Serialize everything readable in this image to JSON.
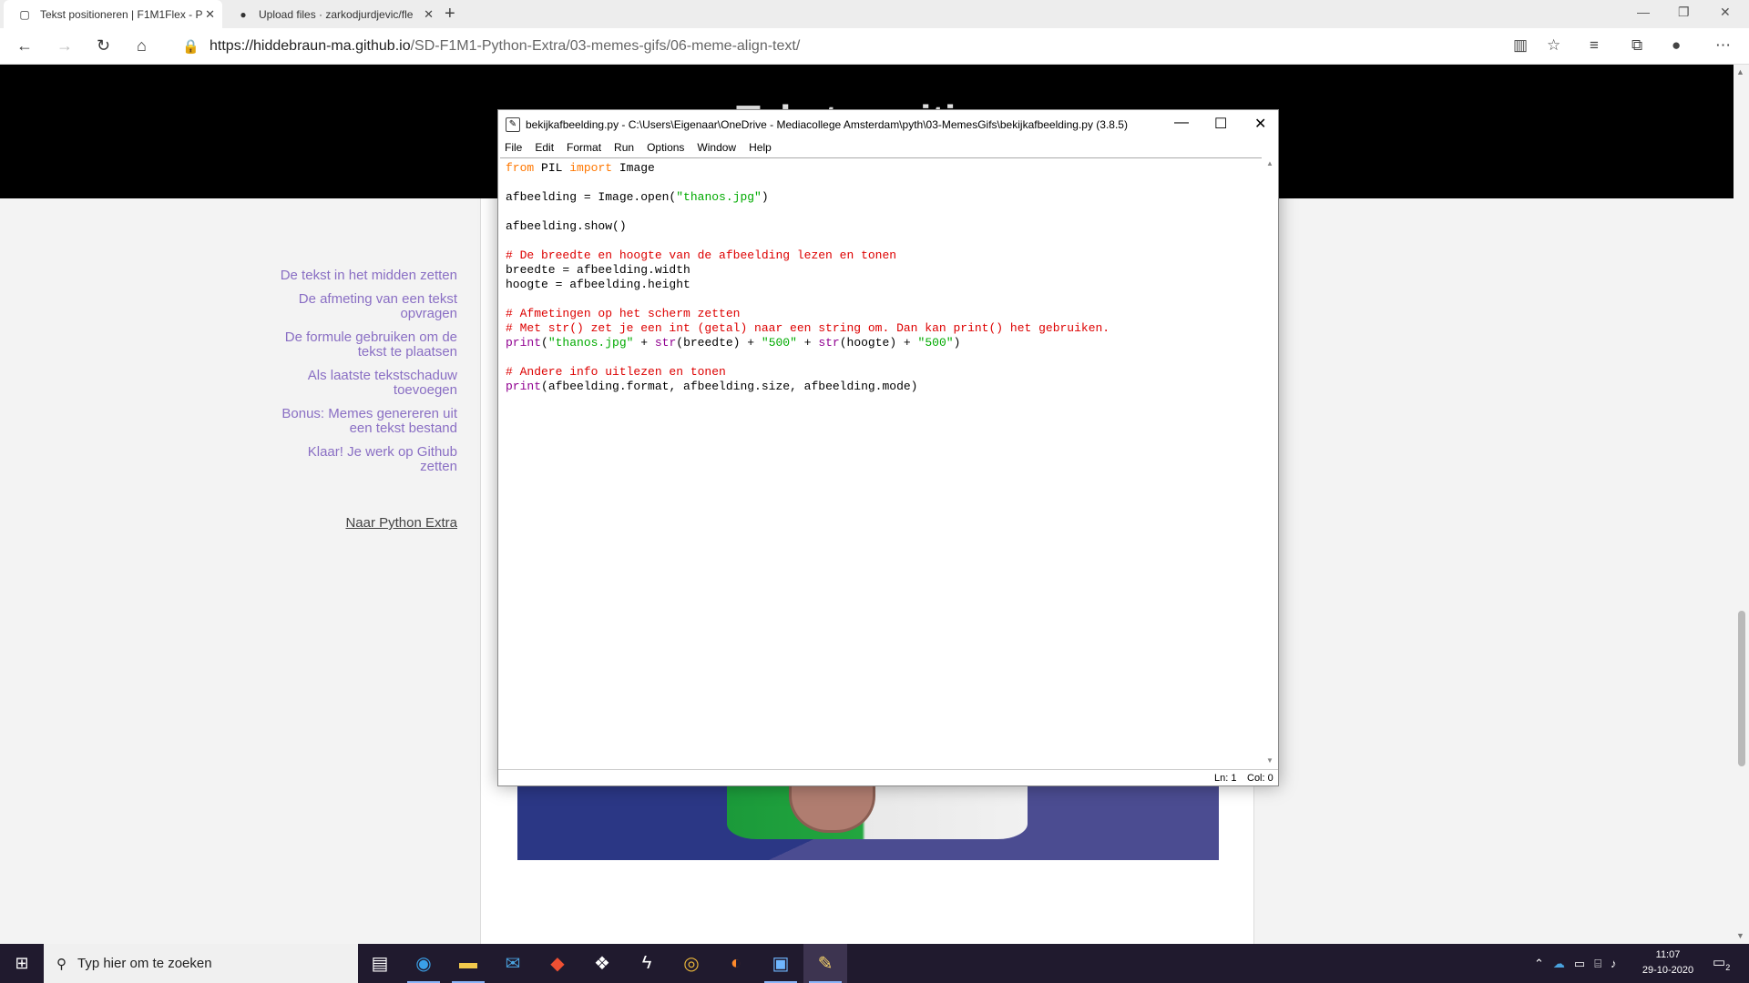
{
  "browser": {
    "tabs": [
      {
        "title": "Tekst positioneren | F1M1Flex - P",
        "icon": "page-icon",
        "active": true
      },
      {
        "title": "Upload files · zarkodjurdjevic/fle",
        "icon": "github-icon",
        "active": false
      }
    ],
    "url_host": "https://hiddebraun-ma.github.io",
    "url_path": "/SD-F1M1-Python-Extra/03-memes-gifs/06-meme-align-text/"
  },
  "page": {
    "hero_title": "Tekst positioneren",
    "side_links": [
      "De tekst in het midden zetten",
      "De afmeting van een tekst opvragen",
      "De formule gebruiken om de tekst te plaatsen",
      "Als laatste tekstschaduw toevoegen",
      "Bonus: Memes genereren uit een tekst bestand",
      "Klaar! Je werk op Github zetten"
    ],
    "back_link": "Naar Python Extra"
  },
  "idle": {
    "title": "bekijkafbeelding.py - C:\\Users\\Eigenaar\\OneDrive - Mediacollege Amsterdam\\pyth\\03-MemesGifs\\bekijkafbeelding.py (3.8.5)",
    "menu": [
      "File",
      "Edit",
      "Format",
      "Run",
      "Options",
      "Window",
      "Help"
    ],
    "code": {
      "l1_from": "from",
      "l1_mod": " PIL ",
      "l1_import": "import",
      "l1_rest": " Image",
      "l3_a": "afbeelding = Image.open(",
      "l3_str": "\"thanos.jpg\"",
      "l3_b": ")",
      "l5": "afbeelding.show()",
      "l7": "# De breedte en hoogte van de afbeelding lezen en tonen",
      "l8": "breedte = afbeelding.width",
      "l9": "hoogte = afbeelding.height",
      "l11": "# Afmetingen op het scherm zetten",
      "l12": "# Met str() zet je een int (getal) naar een string om. Dan kan print() het gebruiken.",
      "l13_print": "print",
      "l13_a": "(",
      "l13_s1": "\"thanos.jpg\"",
      "l13_b": " + ",
      "l13_str1": "str",
      "l13_c": "(breedte) + ",
      "l13_s2": "\"500\"",
      "l13_d": " + ",
      "l13_str2": "str",
      "l13_e": "(hoogte) + ",
      "l13_s3": "\"500\"",
      "l13_f": ")",
      "l15": "# Andere info uitlezen en tonen",
      "l16_print": "print",
      "l16_rest": "(afbeelding.format, afbeelding.size, afbeelding.mode)"
    },
    "status_ln": "Ln: 1",
    "status_col": "Col: 0"
  },
  "taskbar": {
    "search_placeholder": "Typ hier om te zoeken",
    "time": "11:07",
    "date": "29-10-2020",
    "notifications": "2"
  }
}
